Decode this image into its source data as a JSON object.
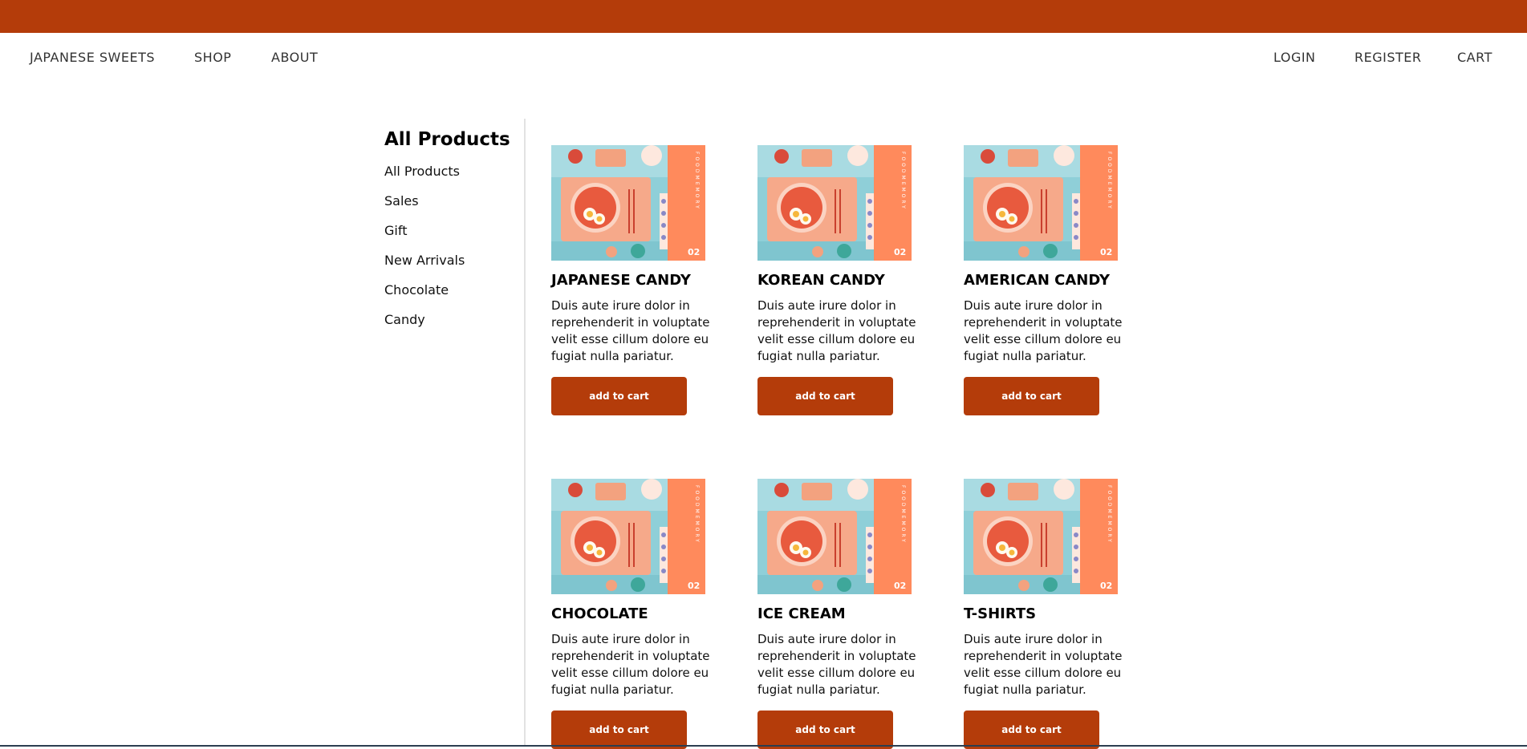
{
  "nav": {
    "brand": "JAPANESE SWEETS",
    "shop": "SHOP",
    "about": "ABOUT",
    "login": "LOGIN",
    "register": "REGISTER",
    "cart": "CART"
  },
  "sidebar": {
    "title": "All Products",
    "items": [
      {
        "label": "All Products"
      },
      {
        "label": "Sales"
      },
      {
        "label": "Gift"
      },
      {
        "label": "New Arrivals"
      },
      {
        "label": "Chocolate"
      },
      {
        "label": "Candy"
      }
    ]
  },
  "products": [
    {
      "title": "JAPANESE CANDY",
      "desc": "Duis aute irure dolor in reprehenderit in voluptate velit esse cillum dolore eu fugiat nulla pariatur.",
      "button": "add to cart",
      "image_badge": "02",
      "image_vertical_text": "FOODMEMORY"
    },
    {
      "title": "KOREAN CANDY",
      "desc": "Duis aute irure dolor in reprehenderit in voluptate velit esse cillum dolore eu fugiat nulla pariatur.",
      "button": "add to cart",
      "image_badge": "02",
      "image_vertical_text": "FOODMEMORY"
    },
    {
      "title": "AMERICAN CANDY",
      "desc": "Duis aute irure dolor in reprehenderit in voluptate velit esse cillum dolore eu fugiat nulla pariatur.",
      "button": "add to cart",
      "image_badge": "02",
      "image_vertical_text": "FOODMEMORY"
    },
    {
      "title": "CHOCOLATE",
      "desc": "Duis aute irure dolor in reprehenderit in voluptate velit esse cillum dolore eu fugiat nulla pariatur.",
      "button": "add to cart",
      "image_badge": "02",
      "image_vertical_text": "FOODMEMORY"
    },
    {
      "title": "ICE CREAM",
      "desc": "Duis aute irure dolor in reprehenderit in voluptate velit esse cillum dolore eu fugiat nulla pariatur.",
      "button": "add to cart",
      "image_badge": "02",
      "image_vertical_text": "FOODMEMORY"
    },
    {
      "title": "T-SHIRTS",
      "desc": "Duis aute irure dolor in reprehenderit in voluptate velit esse cillum dolore eu fugiat nulla pariatur.",
      "button": "add to cart",
      "image_badge": "02",
      "image_vertical_text": "FOODMEMORY"
    }
  ],
  "colors": {
    "accent": "#b43c0a",
    "image_stripe": "#ff8a5c",
    "image_bg": "#8fcfd8"
  }
}
